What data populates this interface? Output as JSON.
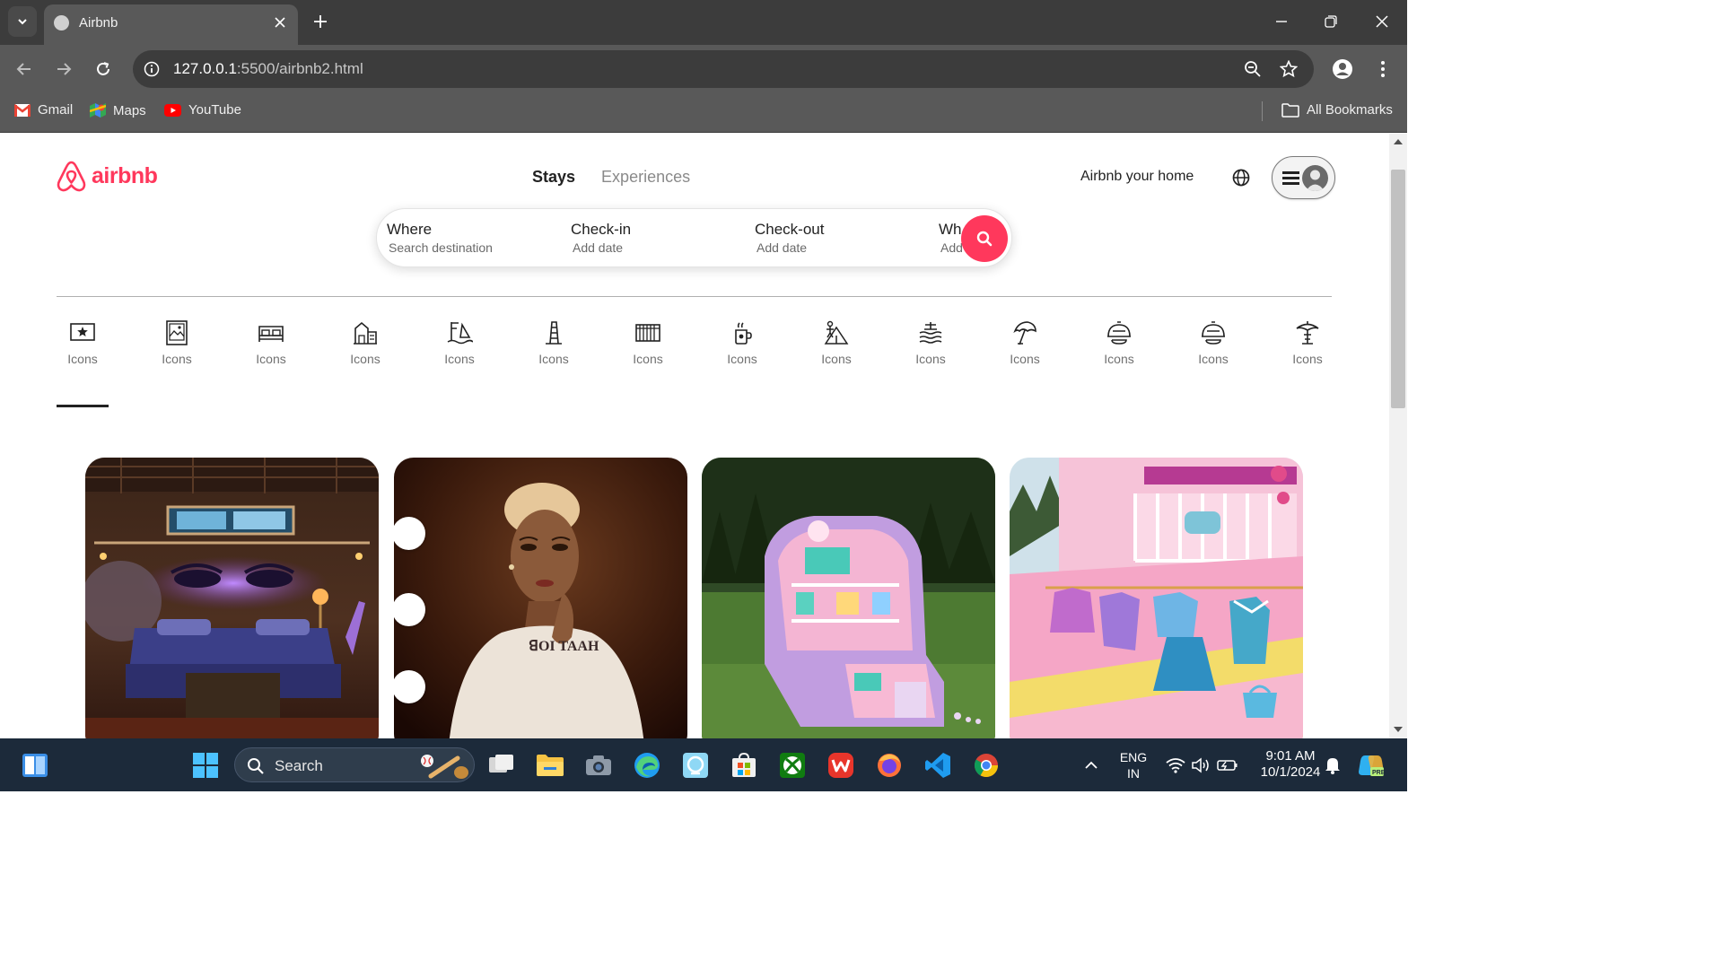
{
  "browser": {
    "tab_title": "Airbnb",
    "url_host": "127.0.0.1",
    "url_path": ":5500/airbnb2.html",
    "bookmarks": [
      {
        "label": "Gmail",
        "icon": "gmail-icon"
      },
      {
        "label": "Maps",
        "icon": "maps-icon"
      },
      {
        "label": "YouTube",
        "icon": "youtube-icon"
      }
    ],
    "all_bookmarks": "All Bookmarks"
  },
  "header": {
    "logo_text": "airbnb",
    "tabs": [
      "Stays",
      "Experiences"
    ],
    "host_link": "Airbnb your home"
  },
  "search": {
    "where_label": "Where",
    "where_value": "Search destination",
    "checkin_label": "Check-in",
    "checkin_value": "Add date",
    "checkout_label": "Check-out",
    "checkout_value": "Add date",
    "who_label": "Wh",
    "who_value": "Add"
  },
  "categories": [
    {
      "label": "Icons",
      "icon": "star-frame-icon"
    },
    {
      "label": "Icons",
      "icon": "picture-frame-icon"
    },
    {
      "label": "Icons",
      "icon": "beds-icon"
    },
    {
      "label": "Icons",
      "icon": "farm-house-icon"
    },
    {
      "label": "Icons",
      "icon": "windsurf-icon"
    },
    {
      "label": "Icons",
      "icon": "tower-icon"
    },
    {
      "label": "Icons",
      "icon": "barn-icon"
    },
    {
      "label": "Icons",
      "icon": "mug-icon"
    },
    {
      "label": "Icons",
      "icon": "campsite-icon"
    },
    {
      "label": "Icons",
      "icon": "lake-icon"
    },
    {
      "label": "Icons",
      "icon": "beach-umbrella-icon"
    },
    {
      "label": "Icons",
      "icon": "dome-icon"
    },
    {
      "label": "Icons",
      "icon": "dome-icon"
    },
    {
      "label": "Icons",
      "icon": "tropical-icon"
    }
  ],
  "listings": [
    {
      "scene": "purple-lit-bedroom-photo"
    },
    {
      "scene": "portrait-woman-lipstick-photo"
    },
    {
      "scene": "pink-compact-dollhouse-photo"
    },
    {
      "scene": "pink-closet-balcony-photo"
    }
  ],
  "taskbar": {
    "search_label": "Search",
    "lang_top": "ENG",
    "lang_bottom": "IN",
    "time": "9:01 AM",
    "date": "10/1/2024"
  },
  "colors": {
    "brand": "#FF385C",
    "tab_bar": "#3c3c3c",
    "toolbar": "#595959",
    "taskbar": "#1c2a3a"
  }
}
